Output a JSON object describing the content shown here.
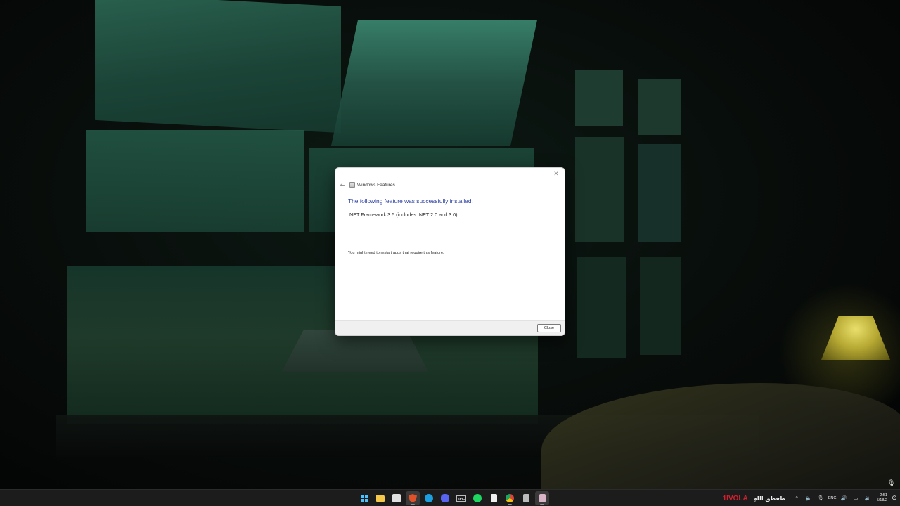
{
  "dialog": {
    "title": "Windows Features",
    "heading": "The following feature was successfully installed:",
    "feature": ".NET Framework 3.5 (includes .NET 2.0 and 3.0)",
    "note": "You might need to restart apps that require this feature.",
    "close_button": "Close",
    "close_icon": "✕",
    "back_icon": "←"
  },
  "taskbar": {
    "apps": [
      {
        "name": "start-icon"
      },
      {
        "name": "file-explorer-icon",
        "color": "#f5c84c"
      },
      {
        "name": "store-icon",
        "color": "#e0e0e0"
      },
      {
        "name": "brave-browser-icon",
        "color": "#e0512a"
      },
      {
        "name": "steam-icon",
        "color": "#1b9fe0"
      },
      {
        "name": "discord-icon",
        "color": "#5865f2"
      },
      {
        "name": "epic-games-icon",
        "color": "#e8e8e8",
        "label": "EPIC"
      },
      {
        "name": "spotify-icon",
        "color": "#1ed760"
      },
      {
        "name": "document-icon",
        "color": "#f0f0f0"
      },
      {
        "name": "chrome-icon",
        "color": "#d9473a"
      },
      {
        "name": "app-icon",
        "color": "#bbbbbb"
      },
      {
        "name": "windows-features-icon",
        "color": "#d8b5c6"
      }
    ],
    "tray": {
      "brand": "1IVOLA",
      "arabic_text": "طفطق اللهِ",
      "lang": "ENG",
      "time": "2:51",
      "date": "5/18/2"
    }
  }
}
